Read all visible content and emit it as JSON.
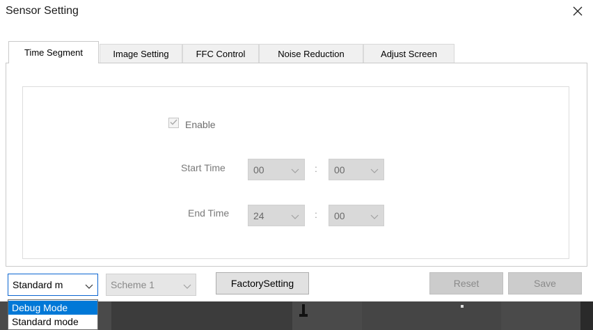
{
  "window": {
    "title": "Sensor Setting",
    "close_icon": "close-icon"
  },
  "tabs": [
    {
      "label": "Time Segment",
      "active": true
    },
    {
      "label": "Image Setting",
      "active": false
    },
    {
      "label": "FFC Control",
      "active": false
    },
    {
      "label": "Noise Reduction",
      "active": false
    },
    {
      "label": "Adjust Screen",
      "active": false
    }
  ],
  "time_segment": {
    "enable_label": "Enable",
    "enable_checked": true,
    "start_time": {
      "label": "Start Time",
      "hour": "00",
      "minute": "00"
    },
    "end_time": {
      "label": "End Time",
      "hour": "24",
      "minute": "00"
    },
    "separator": ":"
  },
  "bottom": {
    "mode_value": "Standard m",
    "scheme_value": "Scheme 1",
    "factory_label": "FactorySetting",
    "reset_label": "Reset",
    "save_label": "Save"
  },
  "mode_dropdown": {
    "options": [
      "Debug Mode",
      "Standard mode"
    ],
    "highlighted": "Debug Mode"
  },
  "colors": {
    "accent": "#0078d7",
    "disabled_fill": "#d9d9d9",
    "tab_inactive": "#f0f0f0"
  }
}
